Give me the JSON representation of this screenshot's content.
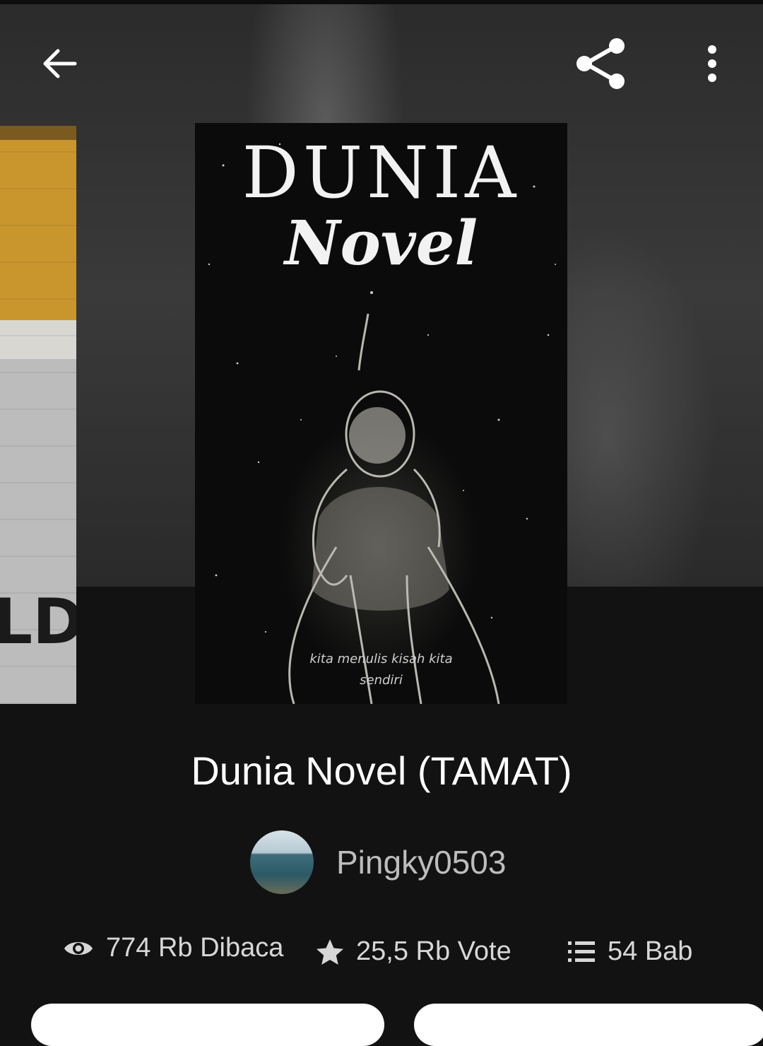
{
  "header": {
    "back_icon": "arrow-left-icon",
    "share_icon": "share-icon",
    "more_icon": "more-vertical-icon"
  },
  "covers": {
    "left_partial_text": "LD",
    "main_title_line1": "DUNIA",
    "main_title_line2": "Novel",
    "main_tagline_line1": "kita menulis kisah kita",
    "main_tagline_line2": "sendiri"
  },
  "story": {
    "title": "Dunia Novel (TAMAT)",
    "author": "Pingky0503"
  },
  "stats": {
    "reads": "774 Rb Dibaca",
    "votes": "25,5 Rb Vote",
    "chapters": "54 Bab"
  },
  "colors": {
    "background": "#121212",
    "text_primary": "#ffffff",
    "text_secondary": "#bdbdbd"
  }
}
